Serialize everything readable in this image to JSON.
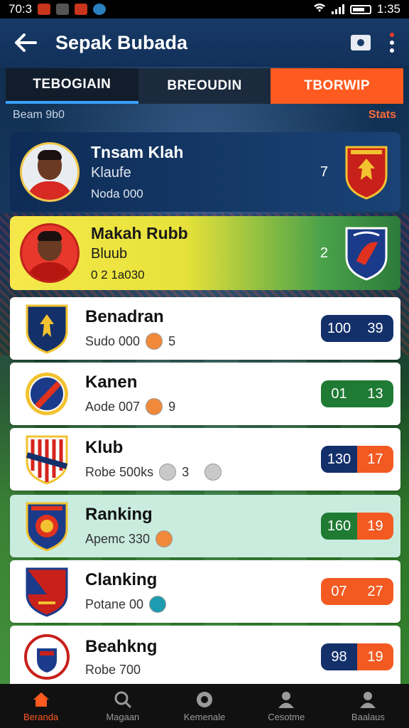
{
  "status_bar": {
    "time": "70:3",
    "clock": "1:35"
  },
  "app_bar": {
    "title": "Sepak Bubada"
  },
  "tabs": [
    {
      "label": "TEBOGIAIN"
    },
    {
      "label": "BREOUDIN"
    },
    {
      "label": "TBORWIP"
    }
  ],
  "subheader": {
    "left": "Beam 9b0",
    "right": "Stats"
  },
  "featured": [
    {
      "name": "Tnsam Klah",
      "club": "Klaufe",
      "meta": "Noda 000",
      "rank": "7"
    },
    {
      "name": "Makah Rubb",
      "club": "Bluub",
      "meta": "0 2 1a030",
      "rank": "2"
    }
  ],
  "rows": [
    {
      "name": "Benadran",
      "sub": "Sudo 000",
      "extra": "5",
      "score_a": "100",
      "score_b": "39",
      "colors": [
        "#13306b",
        "#13306b"
      ]
    },
    {
      "name": "Kanen",
      "sub": "Aode 007",
      "extra": "9",
      "score_a": "01",
      "score_b": "13",
      "colors": [
        "#1f7a34",
        "#1f7a34"
      ]
    },
    {
      "name": "Klub",
      "sub": "Robe 500ks",
      "extra": "3",
      "score_a": "130",
      "score_b": "17",
      "colors": [
        "#13306b",
        "#f25a22"
      ]
    },
    {
      "name": "Ranking",
      "sub": "Apemc 330",
      "extra": "",
      "score_a": "160",
      "score_b": "19",
      "colors": [
        "#1f7a34",
        "#f25a22"
      ]
    },
    {
      "name": "Clanking",
      "sub": "Potane 00",
      "extra": "",
      "score_a": "07",
      "score_b": "27",
      "colors": [
        "#f25a22",
        "#f25a22"
      ]
    },
    {
      "name": "Beahkng",
      "sub": "Robe 700",
      "extra": "",
      "score_a": "98",
      "score_b": "19",
      "colors": [
        "#13306b",
        "#f25a22"
      ]
    }
  ],
  "bottom_nav": [
    {
      "label": "Beranda",
      "icon": "home-icon"
    },
    {
      "label": "Magaan",
      "icon": "search-icon"
    },
    {
      "label": "Kemenale",
      "icon": "ball-icon"
    },
    {
      "label": "Cesotme",
      "icon": "person-icon"
    },
    {
      "label": "Baalaus",
      "icon": "profile-icon"
    }
  ],
  "colors": {
    "accent": "#ff5a1f",
    "app_bar": "#173a66",
    "tab_underline": "#3aa0ff"
  }
}
